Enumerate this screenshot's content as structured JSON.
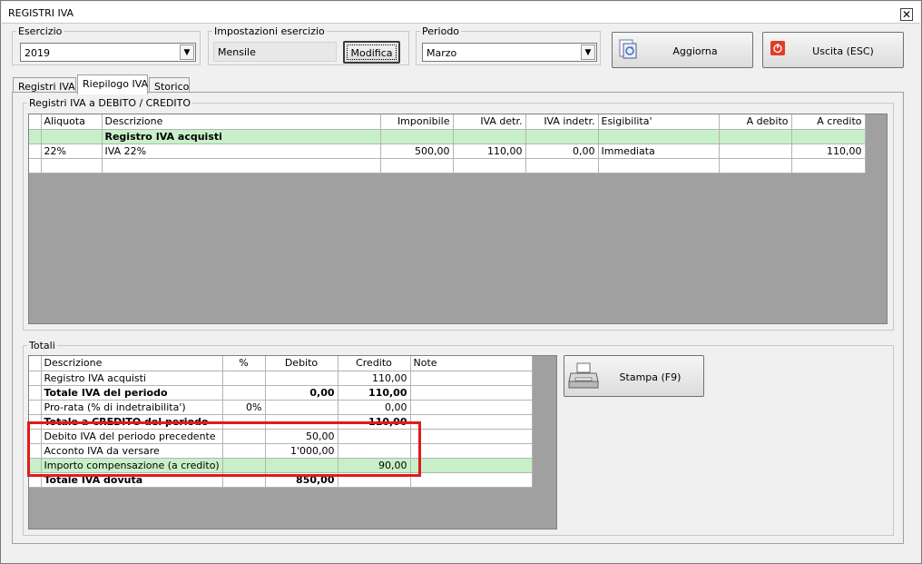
{
  "window": {
    "title": "REGISTRI IVA",
    "close_glyph": "✕"
  },
  "filters": {
    "esercizio": {
      "legend": "Esercizio",
      "value": "2019"
    },
    "impostazioni": {
      "legend": "Impostazioni esercizio",
      "value": "Mensile",
      "button": "Modifica"
    },
    "periodo": {
      "legend": "Periodo",
      "value": "Marzo"
    }
  },
  "toolbar": {
    "aggiorna": "Aggiorna",
    "uscita": "Uscita (ESC)",
    "stampa": "Stampa (F9)"
  },
  "tabs": [
    {
      "label": "Registri IVA"
    },
    {
      "label": "Riepilogo IVA"
    },
    {
      "label": "Storico"
    }
  ],
  "debito_credito": {
    "legend": "Registri IVA a DEBITO / CREDITO",
    "headers": [
      "Aliquota",
      "Descrizione",
      "Imponibile",
      "IVA detr.",
      "IVA indetr.",
      "Esigibilita'",
      "A debito",
      "A credito"
    ],
    "group_label": "Registro IVA acquisti",
    "rows": [
      [
        "22%",
        "IVA 22%",
        "500,00",
        "110,00",
        "0,00",
        "Immediata",
        "",
        "110,00"
      ]
    ]
  },
  "totali": {
    "legend": "Totali",
    "headers": [
      "Descrizione",
      "%",
      "Debito",
      "Credito",
      "Note"
    ],
    "rows": [
      {
        "desc": "Registro IVA acquisti",
        "pct": "",
        "debito": "",
        "credito": "110,00",
        "note": ""
      },
      {
        "desc": "Totale IVA del periodo",
        "pct": "",
        "debito": "0,00",
        "credito": "110,00",
        "note": ""
      },
      {
        "desc": "Pro-rata (% di indetraibilita')",
        "pct": "0%",
        "debito": "",
        "credito": "0,00",
        "note": ""
      },
      {
        "desc": "Totale a CREDITO del periodo",
        "pct": "",
        "debito": "",
        "credito": "110,00",
        "note": ""
      },
      {
        "desc": "Debito IVA del periodo precedente",
        "pct": "",
        "debito": "50,00",
        "credito": "",
        "note": ""
      },
      {
        "desc": "Acconto IVA da versare",
        "pct": "",
        "debito": "1'000,00",
        "credito": "",
        "note": ""
      },
      {
        "desc": "Importo compensazione (a credito)",
        "pct": "",
        "debito": "",
        "credito": "90,00",
        "note": ""
      },
      {
        "desc": "Totale IVA dovuta",
        "pct": "",
        "debito": "850,00",
        "credito": "",
        "note": ""
      }
    ]
  },
  "icons": {
    "aggiorna": "refresh-document-icon",
    "uscita": "power-icon",
    "stampa": "printer-icon"
  },
  "colors": {
    "highlight_row": "#c8f0c8",
    "annotation": "#e01b1b",
    "exit_icon": "#e03c28"
  }
}
